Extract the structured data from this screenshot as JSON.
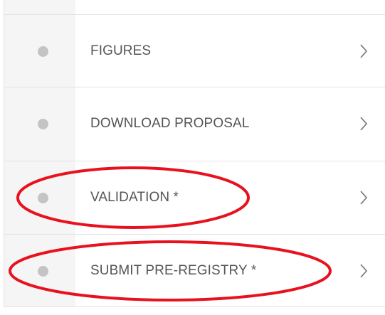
{
  "nav": {
    "items": [
      {
        "label": "FIGURES",
        "status_icon": "status-dot-icon",
        "chevron_icon": "chevron-right-icon"
      },
      {
        "label": "DOWNLOAD PROPOSAL",
        "status_icon": "status-dot-icon",
        "chevron_icon": "chevron-right-icon"
      },
      {
        "label": "VALIDATION *",
        "status_icon": "status-dot-icon",
        "chevron_icon": "chevron-right-icon"
      },
      {
        "label": "SUBMIT PRE-REGISTRY *",
        "status_icon": "status-dot-icon",
        "chevron_icon": "chevron-right-icon"
      }
    ]
  },
  "colors": {
    "dot": "#c4c4c4",
    "text": "#555555",
    "border": "#e3e3e3",
    "gutter": "#f5f5f5",
    "annotation": "#e8121e"
  }
}
